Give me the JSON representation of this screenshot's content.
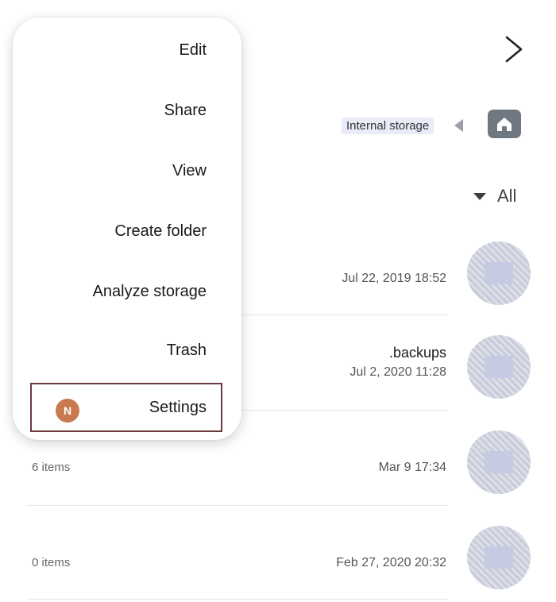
{
  "breadcrumb": {
    "location": "Internal storage"
  },
  "filter": {
    "label": "All"
  },
  "folders": [
    {
      "name": "",
      "date": "Jul 22, 2019 18:52",
      "count": "",
      "blurred": true
    },
    {
      "name": ".backups",
      "date": "Jul 2, 2020 11:28",
      "count": "",
      "blurred": false
    },
    {
      "name": "",
      "date": "Mar 9 17:34",
      "count": "6 items",
      "blurred": true
    },
    {
      "name": "",
      "date": "Feb 27, 2020 20:32",
      "count": "0 items",
      "blurred": true
    }
  ],
  "menu": {
    "items": [
      "Edit",
      "Share",
      "View",
      "Create folder",
      "Analyze storage",
      "Trash",
      "Settings"
    ],
    "settings_badge": "N"
  },
  "colors": {
    "badge": "#c8794f",
    "highlight_border": "#6b3a3f",
    "home_button": "#6f7880"
  }
}
